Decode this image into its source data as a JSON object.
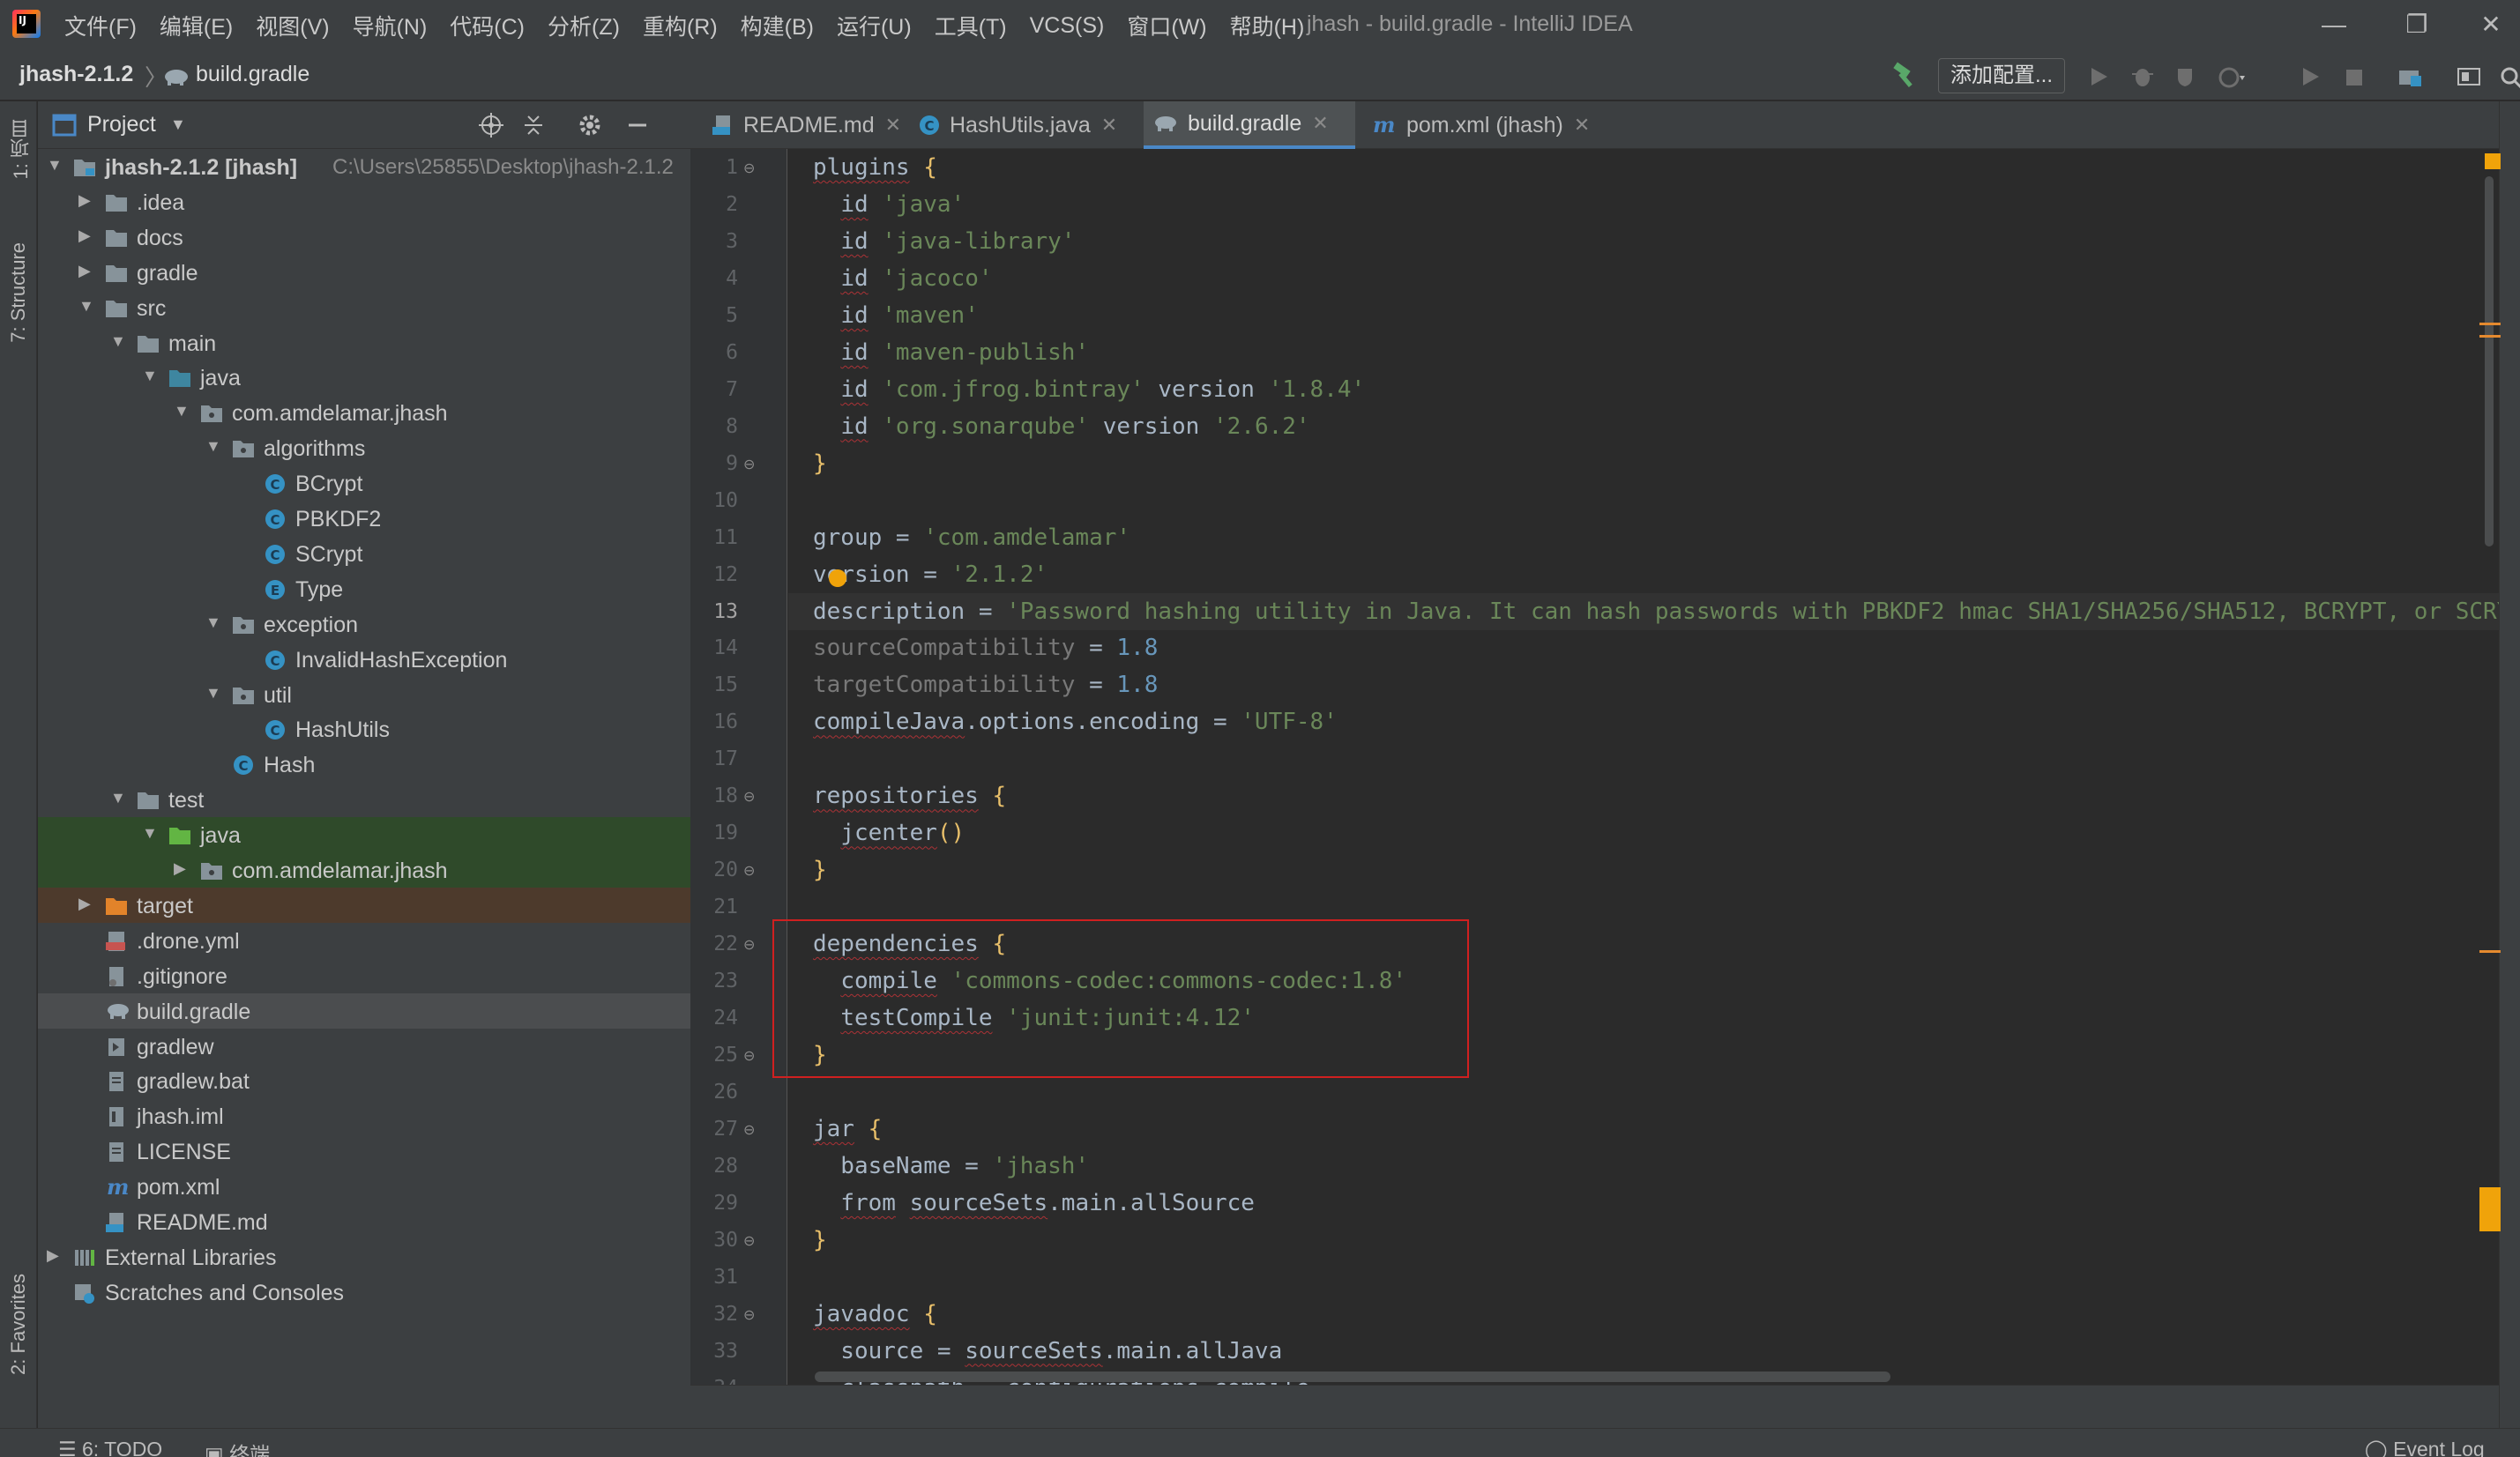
{
  "app": {
    "logo_text": "IJ",
    "window_title": "jhash - build.gradle - IntelliJ IDEA"
  },
  "menu": [
    "文件(F)",
    "编辑(E)",
    "视图(V)",
    "导航(N)",
    "代码(C)",
    "分析(Z)",
    "重构(R)",
    "构建(B)",
    "运行(U)",
    "工具(T)",
    "VCS(S)",
    "窗口(W)",
    "帮助(H)"
  ],
  "window_controls": {
    "minimize": "—",
    "restore": "❐",
    "close": "✕"
  },
  "breadcrumb": {
    "root": "jhash-2.1.2",
    "separator": "〉",
    "file": "build.gradle"
  },
  "toolbar": {
    "add_config_label": "添加配置..."
  },
  "left_strip": {
    "project_tab": "1: 项目",
    "structure_tab": "7: Structure",
    "favorites_tab": "2: Favorites"
  },
  "project_panel": {
    "title": "Project",
    "tree": [
      {
        "depth": 0,
        "arrow": "open",
        "icon": "module-folder",
        "label": "jhash-2.1.2 [jhash]",
        "path": "C:\\Users\\25855\\Desktop\\jhash-2.1.2"
      },
      {
        "depth": 1,
        "arrow": "closed",
        "icon": "folder",
        "label": ".idea"
      },
      {
        "depth": 1,
        "arrow": "closed",
        "icon": "folder",
        "label": "docs"
      },
      {
        "depth": 1,
        "arrow": "closed",
        "icon": "folder",
        "label": "gradle"
      },
      {
        "depth": 1,
        "arrow": "open",
        "icon": "folder",
        "label": "src"
      },
      {
        "depth": 2,
        "arrow": "open",
        "icon": "folder",
        "label": "main"
      },
      {
        "depth": 3,
        "arrow": "open",
        "icon": "source-folder",
        "label": "java"
      },
      {
        "depth": 4,
        "arrow": "open",
        "icon": "package",
        "label": "com.amdelamar.jhash"
      },
      {
        "depth": 5,
        "arrow": "open",
        "icon": "package",
        "label": "algorithms"
      },
      {
        "depth": 6,
        "arrow": "none",
        "icon": "class",
        "label": "BCrypt"
      },
      {
        "depth": 6,
        "arrow": "none",
        "icon": "class",
        "label": "PBKDF2"
      },
      {
        "depth": 6,
        "arrow": "none",
        "icon": "class",
        "label": "SCrypt"
      },
      {
        "depth": 6,
        "arrow": "none",
        "icon": "enum",
        "label": "Type"
      },
      {
        "depth": 5,
        "arrow": "open",
        "icon": "package",
        "label": "exception"
      },
      {
        "depth": 6,
        "arrow": "none",
        "icon": "class",
        "label": "InvalidHashException"
      },
      {
        "depth": 5,
        "arrow": "open",
        "icon": "package",
        "label": "util"
      },
      {
        "depth": 6,
        "arrow": "none",
        "icon": "class",
        "label": "HashUtils"
      },
      {
        "depth": 5,
        "arrow": "none",
        "icon": "class",
        "label": "Hash"
      },
      {
        "depth": 2,
        "arrow": "open",
        "icon": "folder",
        "label": "test"
      },
      {
        "depth": 3,
        "arrow": "open",
        "icon": "test-folder",
        "label": "java",
        "highlight": "test"
      },
      {
        "depth": 4,
        "arrow": "closed",
        "icon": "package",
        "label": "com.amdelamar.jhash",
        "highlight": "test"
      },
      {
        "depth": 1,
        "arrow": "closed",
        "icon": "excluded-folder",
        "label": "target",
        "highlight": "excluded"
      },
      {
        "depth": 1,
        "arrow": "none",
        "icon": "yml-file",
        "label": ".drone.yml"
      },
      {
        "depth": 1,
        "arrow": "none",
        "icon": "ignore-file",
        "label": ".gitignore"
      },
      {
        "depth": 1,
        "arrow": "none",
        "icon": "gradle-file",
        "label": "build.gradle",
        "highlight": "selected"
      },
      {
        "depth": 1,
        "arrow": "none",
        "icon": "script-file",
        "label": "gradlew"
      },
      {
        "depth": 1,
        "arrow": "none",
        "icon": "text-file",
        "label": "gradlew.bat"
      },
      {
        "depth": 1,
        "arrow": "none",
        "icon": "iml-file",
        "label": "jhash.iml"
      },
      {
        "depth": 1,
        "arrow": "none",
        "icon": "text-file",
        "label": "LICENSE"
      },
      {
        "depth": 1,
        "arrow": "none",
        "icon": "maven-file",
        "label": "pom.xml"
      },
      {
        "depth": 1,
        "arrow": "none",
        "icon": "md-file",
        "label": "README.md"
      },
      {
        "depth": 0,
        "arrow": "closed",
        "icon": "libraries",
        "label": "External Libraries"
      },
      {
        "depth": 0,
        "arrow": "none",
        "icon": "scratches",
        "label": "Scratches and Consoles"
      }
    ]
  },
  "editor_tabs": [
    {
      "icon": "md-file",
      "label": "README.md",
      "active": false
    },
    {
      "icon": "class",
      "label": "HashUtils.java",
      "active": false
    },
    {
      "icon": "gradle-file",
      "label": "build.gradle",
      "active": true
    },
    {
      "icon": "maven-file",
      "label": "pom.xml (jhash)",
      "active": false
    }
  ],
  "editor": {
    "highlighted_line": 13,
    "lines": [
      [
        [
          "kw",
          "plugins"
        ],
        [
          "p",
          " "
        ],
        [
          "br",
          "{"
        ]
      ],
      [
        [
          "p",
          "  "
        ],
        [
          "kw",
          "id"
        ],
        [
          "p",
          " "
        ],
        [
          "str",
          "'java'"
        ]
      ],
      [
        [
          "p",
          "  "
        ],
        [
          "kw",
          "id"
        ],
        [
          "p",
          " "
        ],
        [
          "str",
          "'java-library'"
        ]
      ],
      [
        [
          "p",
          "  "
        ],
        [
          "kw",
          "id"
        ],
        [
          "p",
          " "
        ],
        [
          "str",
          "'jacoco'"
        ]
      ],
      [
        [
          "p",
          "  "
        ],
        [
          "kw",
          "id"
        ],
        [
          "p",
          " "
        ],
        [
          "str",
          "'maven'"
        ]
      ],
      [
        [
          "p",
          "  "
        ],
        [
          "kw",
          "id"
        ],
        [
          "p",
          " "
        ],
        [
          "str",
          "'maven-publish'"
        ]
      ],
      [
        [
          "p",
          "  "
        ],
        [
          "kw",
          "id"
        ],
        [
          "p",
          " "
        ],
        [
          "str",
          "'com.jfrog.bintray'"
        ],
        [
          "p",
          " version "
        ],
        [
          "str",
          "'1.8.4'"
        ]
      ],
      [
        [
          "p",
          "  "
        ],
        [
          "kw",
          "id"
        ],
        [
          "p",
          " "
        ],
        [
          "str",
          "'org.sonarqube'"
        ],
        [
          "p",
          " version "
        ],
        [
          "str",
          "'2.6.2'"
        ]
      ],
      [
        [
          "br",
          "}"
        ]
      ],
      [],
      [
        [
          "p",
          "group = "
        ],
        [
          "str",
          "'com.amdelamar'"
        ]
      ],
      [
        [
          "p",
          "version = "
        ],
        [
          "str",
          "'2.1.2'"
        ]
      ],
      [
        [
          "p",
          "description = "
        ],
        [
          "str",
          "'Password hashing utility in Java. It can hash passwords with PBKDF2 hmac SHA1/SHA256/SHA512, BCRYPT, or SCRYPT'"
        ]
      ],
      [
        [
          "dim",
          "sourceCompatibility"
        ],
        [
          "p",
          " = "
        ],
        [
          "num",
          "1.8"
        ]
      ],
      [
        [
          "dim",
          "targetCompatibility"
        ],
        [
          "p",
          " = "
        ],
        [
          "num",
          "1.8"
        ]
      ],
      [
        [
          "kw",
          "compileJava"
        ],
        [
          "p",
          ".options.encoding = "
        ],
        [
          "str",
          "'UTF-8'"
        ]
      ],
      [],
      [
        [
          "kw",
          "repositories"
        ],
        [
          "p",
          " "
        ],
        [
          "br",
          "{"
        ]
      ],
      [
        [
          "p",
          "  "
        ],
        [
          "kw",
          "jcenter"
        ],
        [
          "br",
          "()"
        ]
      ],
      [
        [
          "br",
          "}"
        ]
      ],
      [],
      [
        [
          "kw",
          "dependencies"
        ],
        [
          "p",
          " "
        ],
        [
          "br",
          "{"
        ]
      ],
      [
        [
          "p",
          "  "
        ],
        [
          "kw",
          "compile"
        ],
        [
          "p",
          " "
        ],
        [
          "str",
          "'commons-codec:commons-codec:1.8'"
        ]
      ],
      [
        [
          "p",
          "  "
        ],
        [
          "kw",
          "testCompile"
        ],
        [
          "p",
          " "
        ],
        [
          "str",
          "'junit:junit:4.12'"
        ]
      ],
      [
        [
          "br",
          "}"
        ]
      ],
      [],
      [
        [
          "kw",
          "jar"
        ],
        [
          "p",
          " "
        ],
        [
          "br",
          "{"
        ]
      ],
      [
        [
          "p",
          "  baseName = "
        ],
        [
          "str",
          "'jhash'"
        ]
      ],
      [
        [
          "p",
          "  "
        ],
        [
          "kw",
          "from"
        ],
        [
          "p",
          " "
        ],
        [
          "kw",
          "sourceSets"
        ],
        [
          "p",
          ".main.allSource"
        ]
      ],
      [
        [
          "br",
          "}"
        ]
      ],
      [],
      [
        [
          "kw",
          "javadoc"
        ],
        [
          "p",
          " "
        ],
        [
          "br",
          "{"
        ]
      ],
      [
        [
          "p",
          "  source = "
        ],
        [
          "kw",
          "sourceSets"
        ],
        [
          "p",
          ".main.allJava"
        ]
      ],
      [
        [
          "p",
          "  classpath = configurations.compile"
        ]
      ]
    ]
  },
  "bottom_bar": {
    "todo_label": "6: TODO",
    "terminal_label": "终端",
    "event_log_label": "Event Log"
  }
}
